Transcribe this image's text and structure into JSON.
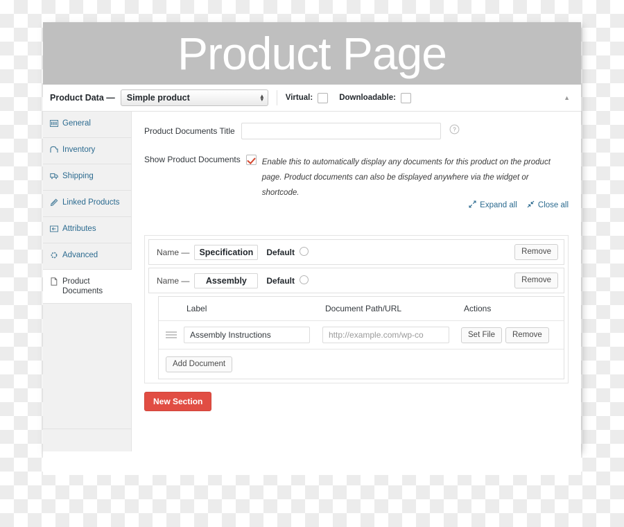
{
  "banner": {
    "title": "Product Page"
  },
  "product_data_bar": {
    "label": "Product Data —",
    "select_value": "Simple product",
    "select_options": [
      "Simple product"
    ],
    "virtual_label": "Virtual:",
    "virtual_checked": false,
    "downloadable_label": "Downloadable:",
    "downloadable_checked": false,
    "collapse_icon": "triangle-up-icon"
  },
  "sidebar": {
    "items": [
      {
        "label": "General",
        "icon": "general-icon",
        "active": false
      },
      {
        "label": "Inventory",
        "icon": "inventory-icon",
        "active": false
      },
      {
        "label": "Shipping",
        "icon": "shipping-truck-icon",
        "active": false
      },
      {
        "label": "Linked Products",
        "icon": "link-pencil-icon",
        "active": false
      },
      {
        "label": "Attributes",
        "icon": "attributes-icon",
        "active": false
      },
      {
        "label": "Advanced",
        "icon": "gear-icon",
        "active": false
      },
      {
        "label": "Product Documents",
        "icon": "document-icon",
        "active": true
      }
    ]
  },
  "panel": {
    "title_field": {
      "label": "Product Documents Title",
      "value": "",
      "placeholder": "",
      "help_icon": "help-circle-icon"
    },
    "show_documents": {
      "label": "Show Product Documents",
      "checked": true,
      "description": "Enable this to automatically display any documents for this product on the product page. Product documents can also be displayed anywhere via the widget or shortcode."
    },
    "expand_all": "Expand all",
    "close_all": "Close all",
    "sections": [
      {
        "name_label": "Name —",
        "name_value": "Specification",
        "default_label": "Default",
        "default_selected": false,
        "remove_label": "Remove",
        "expanded": false
      },
      {
        "name_label": "Name —",
        "name_value": "Assembly",
        "default_label": "Default",
        "default_selected": false,
        "remove_label": "Remove",
        "expanded": true
      }
    ],
    "documents_table": {
      "columns": [
        "Label",
        "Document Path/URL",
        "Actions"
      ],
      "rows": [
        {
          "handle_icon": "drag-handle-icon",
          "label_value": "Assembly Instructions",
          "path_value": "",
          "path_placeholder": "http://example.com/wp-co",
          "set_file_label": "Set File",
          "remove_label": "Remove"
        }
      ],
      "add_document_label": "Add Document"
    },
    "new_section_label": "New Section"
  },
  "colors": {
    "banner_bg": "#bfbfbf",
    "sidebar_link": "#2b6a8f",
    "accent_red": "#e14d43",
    "check_red": "#d4462e",
    "panel_bg": "#ffffff"
  }
}
